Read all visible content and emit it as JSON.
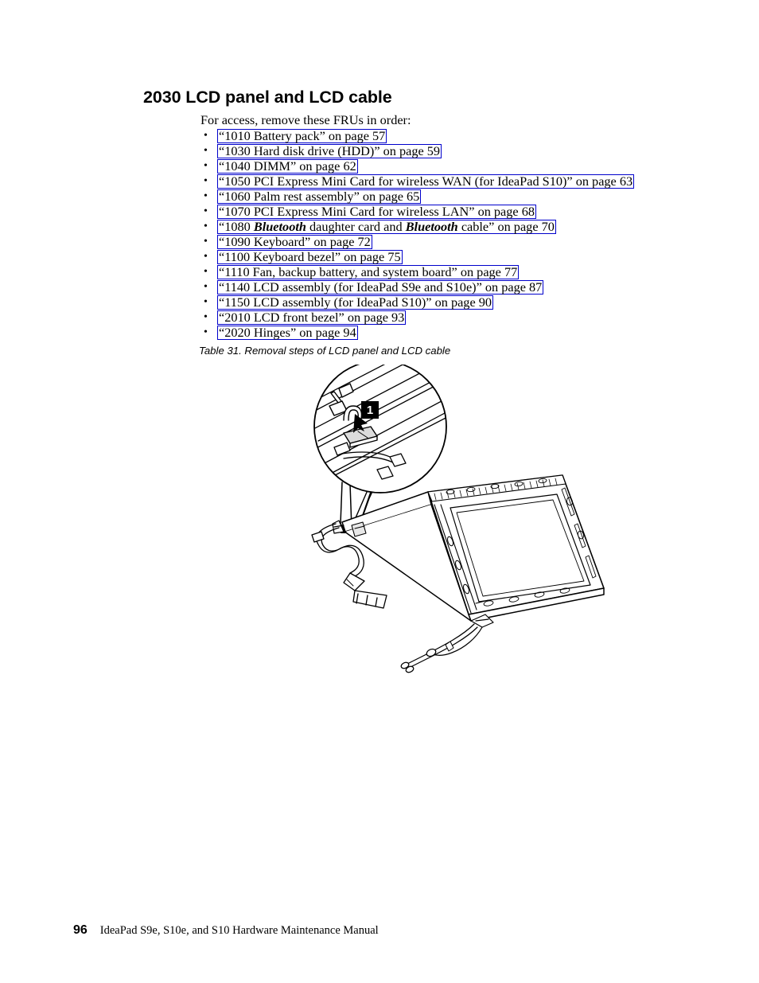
{
  "heading": "2030 LCD panel and LCD cable",
  "intro": "For access, remove these FRUs in order:",
  "bullet_glyph": "•",
  "link_color": "#0000CC",
  "fru_list": [
    {
      "pre": "“1010 Battery pack” on page 57",
      "em": "",
      "post": ""
    },
    {
      "pre": "“1030 Hard disk drive (HDD)” on page 59",
      "em": "",
      "post": ""
    },
    {
      "pre": "“1040 DIMM” on page 62",
      "em": "",
      "post": ""
    },
    {
      "pre": "“1050 PCI Express Mini Card for wireless WAN (for IdeaPad S10)” on page 63",
      "em": "",
      "post": ""
    },
    {
      "pre": "“1060 Palm rest assembly” on page 65",
      "em": "",
      "post": ""
    },
    {
      "pre": "“1070 PCI Express Mini Card for wireless LAN” on page 68",
      "em": "",
      "post": ""
    },
    {
      "pre": "“1080 ",
      "em": "Bluetooth",
      "post": " daughter card and ",
      "em2": "Bluetooth",
      "post2": " cable” on page 70"
    },
    {
      "pre": "“1090 Keyboard” on page 72",
      "em": "",
      "post": ""
    },
    {
      "pre": "“1100 Keyboard bezel” on page 75",
      "em": "",
      "post": ""
    },
    {
      "pre": "“1110 Fan, backup battery, and system board” on page 77",
      "em": "",
      "post": ""
    },
    {
      "pre": "“1140 LCD assembly (for IdeaPad S9e and S10e)” on page 87",
      "em": "",
      "post": ""
    },
    {
      "pre": "“1150 LCD assembly (for IdeaPad S10)” on page 90",
      "em": "",
      "post": ""
    },
    {
      "pre": "“2010 LCD front bezel” on page 93",
      "em": "",
      "post": ""
    },
    {
      "pre": "“2020 Hinges” on page 94",
      "em": "",
      "post": ""
    }
  ],
  "table_caption": "Table 31. Removal steps of LCD panel and LCD cable",
  "figure": {
    "callout_label": "1",
    "description": "Isometric line drawing of an LCD panel inside the LCD rear cover with LCD cable and antenna cables; a circular magnified detail view at the top shows the LCD cable connector with callout 1."
  },
  "footer": {
    "page_number": "96",
    "manual_title": "IdeaPad S9e, S10e, and S10 Hardware Maintenance Manual"
  }
}
